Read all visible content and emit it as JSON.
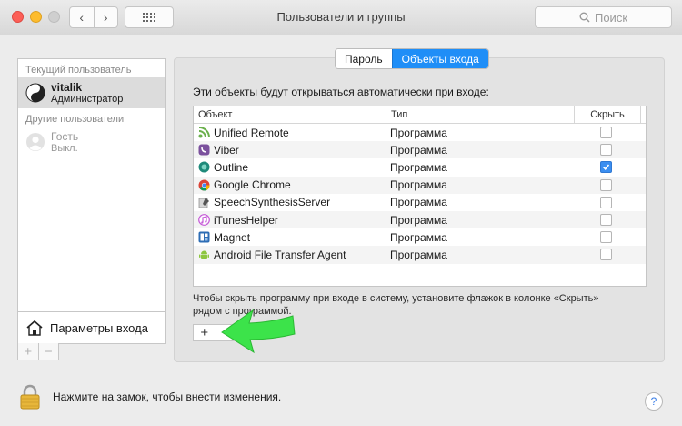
{
  "window": {
    "title": "Пользователи и группы",
    "search_placeholder": "Поиск",
    "nav_back": "‹",
    "nav_forward": "›"
  },
  "sidebar": {
    "current_header": "Текущий пользователь",
    "current_user": {
      "name": "vitalik",
      "role": "Администратор"
    },
    "others_header": "Другие пользователи",
    "guest": {
      "name": "Гость",
      "role": "Выкл."
    },
    "login_options": "Параметры входа",
    "add": "+",
    "remove": "−"
  },
  "tabs": [
    {
      "label": "Пароль",
      "active": false
    },
    {
      "label": "Объекты входа",
      "active": true
    }
  ],
  "panel": {
    "description": "Эти объекты будут открываться автоматически при входе:",
    "columns": [
      "Объект",
      "Тип",
      "Скрыть"
    ],
    "items": [
      {
        "name": "Unified Remote",
        "type": "Программа",
        "hide": false,
        "icon": "unified-remote-icon"
      },
      {
        "name": "Viber",
        "type": "Программа",
        "hide": false,
        "icon": "viber-icon"
      },
      {
        "name": "Outline",
        "type": "Программа",
        "hide": true,
        "icon": "outline-icon"
      },
      {
        "name": "Google Chrome",
        "type": "Программа",
        "hide": false,
        "icon": "chrome-icon"
      },
      {
        "name": "SpeechSynthesisServer",
        "type": "Программа",
        "hide": false,
        "icon": "speech-icon"
      },
      {
        "name": "iTunesHelper",
        "type": "Программа",
        "hide": false,
        "icon": "itunes-icon"
      },
      {
        "name": "Magnet",
        "type": "Программа",
        "hide": false,
        "icon": "magnet-icon"
      },
      {
        "name": "Android File Transfer Agent",
        "type": "Программа",
        "hide": false,
        "icon": "android-icon"
      }
    ],
    "hint": "Чтобы скрыть программу при входе в систему, установите флажок в колонке «Скрыть» рядом с программой.",
    "add": "+",
    "remove": "−"
  },
  "footer": {
    "lock_text": "Нажмите на замок, чтобы внести изменения.",
    "help": "?"
  },
  "colors": {
    "accent": "#1f8ef7",
    "arrow": "#3ce34a"
  }
}
